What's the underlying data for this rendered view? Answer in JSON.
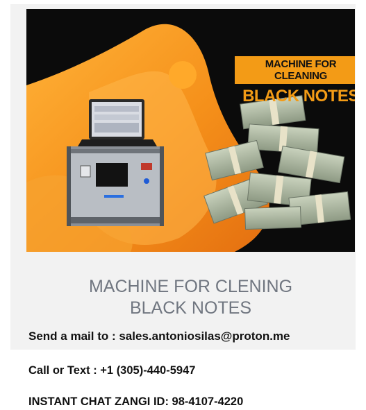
{
  "banner": {
    "headline_line1": "MACHINE FOR CLEANING",
    "headline_line2": "BLACK NOTES"
  },
  "caption": {
    "line1": "MACHINE FOR CLENING",
    "line2": "BLACK NOTES"
  },
  "contact": {
    "email_line": "Send a mail to : sales.antoniosilas@proton.me",
    "phone_line": "Call  or Text : +1 (305)-440-5947",
    "chat_line": "INSTANT CHAT ZANGI ID: 98-4107-4220"
  },
  "colors": {
    "accent_orange": "#f39b16",
    "background_dark": "#0b0b0b",
    "caption_gray": "#707680"
  }
}
